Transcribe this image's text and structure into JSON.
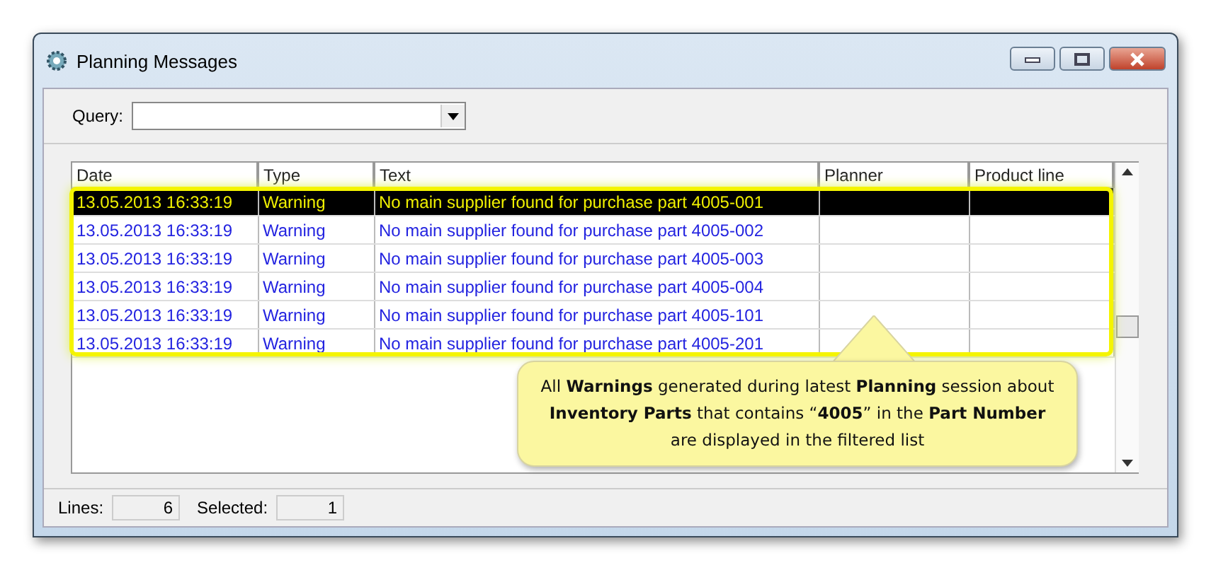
{
  "window": {
    "title": "Planning Messages"
  },
  "query": {
    "label": "Query:"
  },
  "table": {
    "columns": [
      "Date",
      "Type",
      "Text",
      "Planner",
      "Product line"
    ],
    "rows": [
      {
        "cells": [
          "13.05.2013 16:33:19",
          "Warning",
          "No main supplier found for purchase part 4005-001"
        ],
        "selected": true
      },
      {
        "cells": [
          "13.05.2013 16:33:19",
          "Warning",
          "No main supplier found for purchase part 4005-002"
        ],
        "selected": false
      },
      {
        "cells": [
          "13.05.2013 16:33:19",
          "Warning",
          "No main supplier found for purchase part 4005-003"
        ],
        "selected": false
      },
      {
        "cells": [
          "13.05.2013 16:33:19",
          "Warning",
          "No main supplier found for purchase part 4005-004"
        ],
        "selected": false
      },
      {
        "cells": [
          "13.05.2013 16:33:19",
          "Warning",
          "No main supplier found for purchase part 4005-101"
        ],
        "selected": false
      },
      {
        "cells": [
          "13.05.2013 16:33:19",
          "Warning",
          "No main supplier found for purchase part 4005-201"
        ],
        "selected": false
      }
    ]
  },
  "callout": {
    "text": "All **Warnings** generated during latest **Planning** session about **Inventory Parts** that contains “**4005**” in the **Part Number** are displayed in the filtered list"
  },
  "status_bar": [
    {
      "label": "Lines:",
      "value": "6"
    },
    {
      "label": "Selected:",
      "value": "1"
    }
  ]
}
